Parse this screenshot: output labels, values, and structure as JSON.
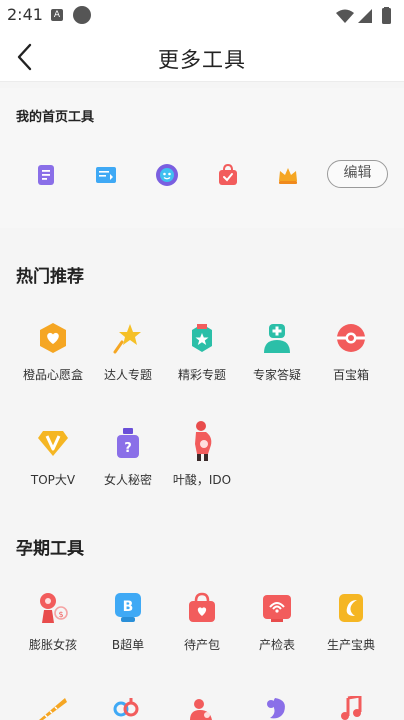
{
  "status_bar": {
    "time": "2:41",
    "notification_badge": "A"
  },
  "header": {
    "title": "更多工具",
    "back_icon": "chevron-left-icon"
  },
  "home_tools": {
    "title": "我的首页工具",
    "icons": [
      "document-icon",
      "card-icon",
      "face-badge-icon",
      "shopping-bag-icon",
      "crown-icon"
    ],
    "edit_label": "编辑"
  },
  "hot": {
    "title": "热门推荐",
    "items": [
      {
        "label": "橙品心愿盒",
        "icon": "heart-box-icon"
      },
      {
        "label": "达人专题",
        "icon": "star-wand-icon"
      },
      {
        "label": "精彩专题",
        "icon": "star-badge-icon"
      },
      {
        "label": "专家答疑",
        "icon": "doctor-icon"
      },
      {
        "label": "百宝箱",
        "icon": "treasure-ball-icon"
      },
      {
        "label": "TOP大V",
        "icon": "diamond-v-icon"
      },
      {
        "label": "女人秘密",
        "icon": "perfume-bottle-icon"
      },
      {
        "label": "叶酸，IDO",
        "icon": "pregnant-woman-icon"
      }
    ]
  },
  "pregnancy": {
    "title": "孕期工具",
    "items": [
      {
        "label": "膨胀女孩",
        "icon": "balloon-girl-icon"
      },
      {
        "label": "B超单",
        "icon": "ultrasound-icon"
      },
      {
        "label": "待产包",
        "icon": "maternity-bag-icon"
      },
      {
        "label": "产检表",
        "icon": "checkup-list-icon"
      },
      {
        "label": "生产宝典",
        "icon": "baby-book-icon"
      }
    ],
    "partial_icons": [
      "ruler-icon",
      "gender-icon",
      "mother-baby-icon",
      "fetus-icon",
      "music-note-icon"
    ]
  },
  "colors": {
    "background": "#f5f5f5",
    "header": "#ffffff",
    "orange": "#f5a623",
    "red": "#f25c5c",
    "teal": "#2bbfa8",
    "purple": "#8a6fe8",
    "blue": "#3fa9f5"
  }
}
